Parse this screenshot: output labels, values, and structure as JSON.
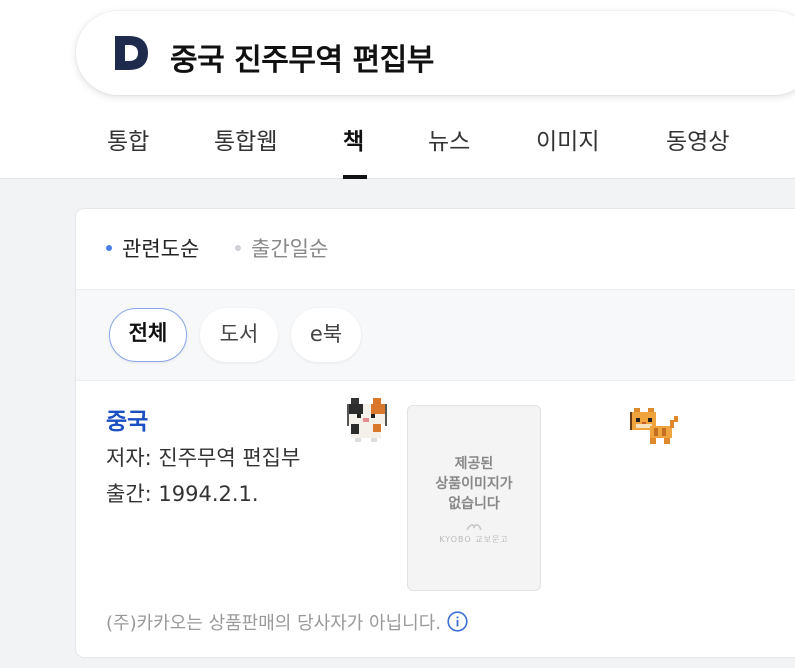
{
  "search": {
    "logo_letter": "D",
    "query": "중국 진주무역 편집부"
  },
  "tabs": [
    {
      "label": "통합",
      "active": false
    },
    {
      "label": "통합웹",
      "active": false
    },
    {
      "label": "책",
      "active": true
    },
    {
      "label": "뉴스",
      "active": false
    },
    {
      "label": "이미지",
      "active": false
    },
    {
      "label": "동영상",
      "active": false
    }
  ],
  "sort": {
    "options": [
      {
        "label": "관련도순",
        "active": true
      },
      {
        "label": "출간일순",
        "active": false
      }
    ]
  },
  "filters": [
    {
      "label": "전체",
      "active": true
    },
    {
      "label": "도서",
      "active": false
    },
    {
      "label": "e북",
      "active": false
    }
  ],
  "result": {
    "title": "중국",
    "author": "저자: 진주무역 편집부",
    "published": "출간: 1994.2.1.",
    "thumbnail_placeholder": "제공된\n상품이미지가\n없습니다",
    "thumbnail_brand": "KYOBO 교보문고"
  },
  "notice": "(주)카카오는 상품판매의 당사자가 아닙니다.",
  "colors": {
    "accent": "#1b4fc4",
    "sort_dot_active": "#4a7ee8",
    "chip_border_active": "#8aa6e8",
    "logo": "#1f2b4d"
  },
  "icons": {
    "logo": "daum-d-logo",
    "info": "info-circle-icon",
    "pet_left": "calico-cat-sprite",
    "pet_right": "orange-cat-sprite"
  }
}
